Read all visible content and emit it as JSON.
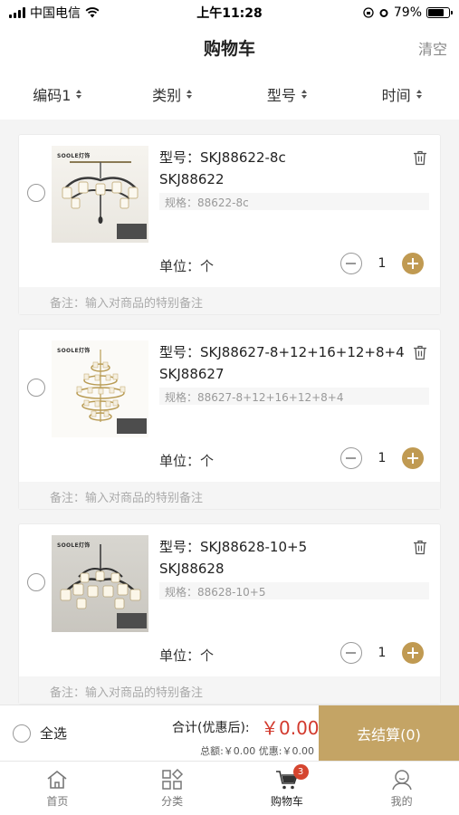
{
  "status": {
    "carrier": "中国电信",
    "time": "上午11:28",
    "battery": "79%",
    "battery_level": 0.79
  },
  "nav": {
    "title": "购物车",
    "clear_label": "清空"
  },
  "filters": [
    {
      "label": "编码1"
    },
    {
      "label": "类别"
    },
    {
      "label": "型号"
    },
    {
      "label": "时间"
    }
  ],
  "items": [
    {
      "model": "型号：SKJ88622-8c",
      "code": "SKJ88622",
      "spec": "规格：88622-8c",
      "unit": "单位：个",
      "quantity": "1",
      "note_placeholder": "备注：输入对商品的特别备注",
      "brand": "SOOLE灯饰"
    },
    {
      "model": "型号：SKJ88627-8+12+16+12+8+4",
      "code": "SKJ88627",
      "spec": "规格：88627-8+12+16+12+8+4",
      "unit": "单位：个",
      "quantity": "1",
      "note_placeholder": "备注：输入对商品的特别备注",
      "brand": "SOOLE灯饰"
    },
    {
      "model": "型号：SKJ88628-10+5",
      "code": "SKJ88628",
      "spec": "规格：88628-10+5",
      "unit": "单位：个",
      "quantity": "1",
      "note_placeholder": "备注：输入对商品的特别备注",
      "brand": "SOOLE灯饰"
    }
  ],
  "summary": {
    "select_all_label": "全选",
    "total_label": "合计(优惠后):",
    "total_value": "￥0.00",
    "total_detail": "总额:￥0.00 优惠:￥0.00",
    "checkout_label": "去结算(0)"
  },
  "tabs": [
    {
      "label": "首页",
      "icon": "home-icon"
    },
    {
      "label": "分类",
      "icon": "category-icon"
    },
    {
      "label": "购物车",
      "icon": "cart-icon",
      "badge": "3"
    },
    {
      "label": "我的",
      "icon": "user-icon"
    }
  ],
  "colors": {
    "accent": "#c4a465",
    "price": "#d23a2e",
    "badge": "#d5452f"
  }
}
